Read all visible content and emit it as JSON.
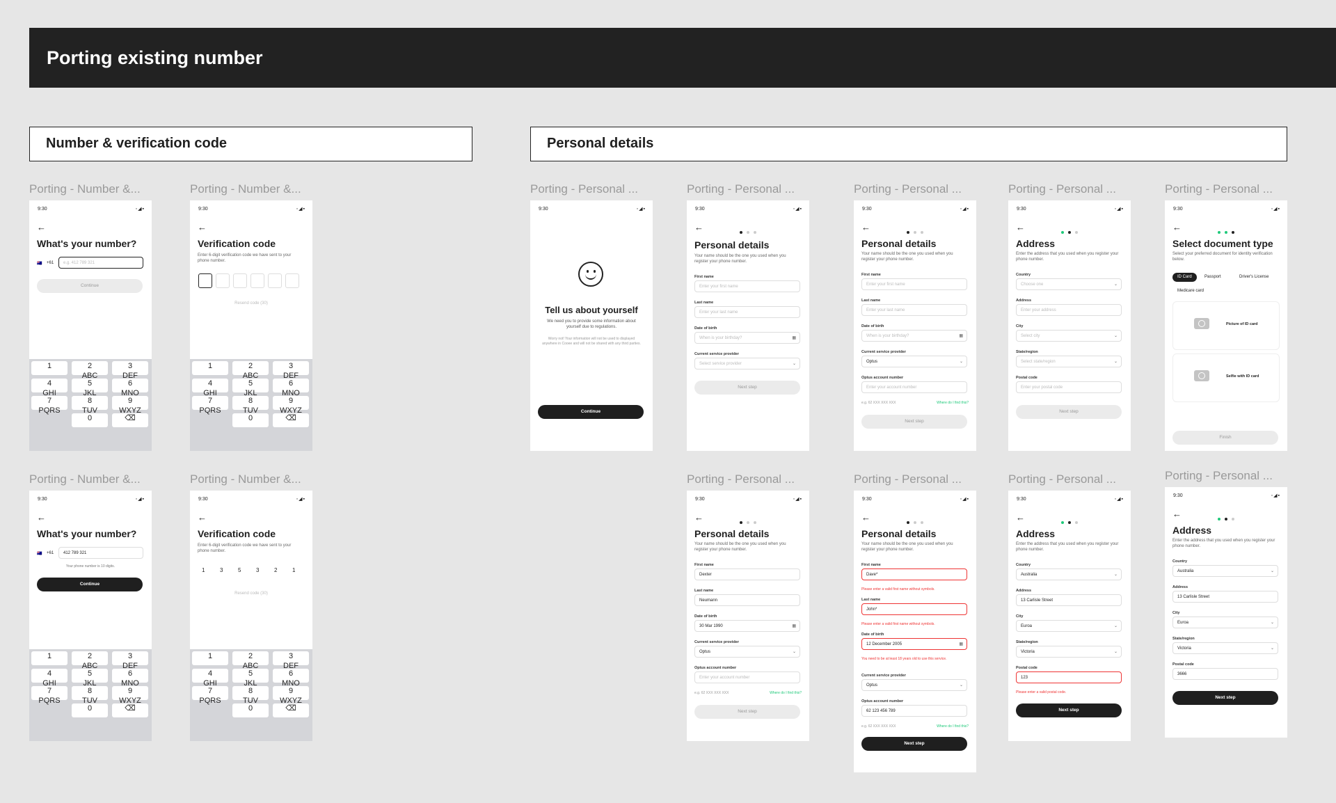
{
  "banner": "Porting existing number",
  "sections": {
    "number": "Number & verification code",
    "personal": "Personal details"
  },
  "labels": {
    "number": "Porting - Number &...",
    "personal": "Porting - Personal ..."
  },
  "time": "9:30",
  "status_icons": "◦◢▪",
  "back": "←",
  "num": {
    "title": "What's your number?",
    "flag": "🇦🇺",
    "code": "+61",
    "placeholder": "e.g. 412 789 321",
    "filled": "412 789 321",
    "helper": "Your phone number is 10 digits.",
    "continue": "Continue"
  },
  "ver": {
    "title": "Verification code",
    "sub": "Enter 6-digit verification code we have sent to your phone number.",
    "resend": "Resend code (30)",
    "digits": [
      "1",
      "3",
      "5",
      "3",
      "2",
      "1"
    ]
  },
  "keypad": [
    {
      "n": "1",
      "l": ""
    },
    {
      "n": "2",
      "l": "ABC"
    },
    {
      "n": "3",
      "l": "DEF"
    },
    {
      "n": "4",
      "l": "GHI"
    },
    {
      "n": "5",
      "l": "JKL"
    },
    {
      "n": "6",
      "l": "MNO"
    },
    {
      "n": "7",
      "l": "PQRS"
    },
    {
      "n": "8",
      "l": "TUV"
    },
    {
      "n": "9",
      "l": "WXYZ"
    },
    {
      "n": "",
      "l": ""
    },
    {
      "n": "0",
      "l": ""
    },
    {
      "n": "⌫",
      "l": ""
    }
  ],
  "intro": {
    "title": "Tell us about yourself",
    "p1": "We need you to provide some information about yourself due to regulations.",
    "p2": "Worry not! Your information will not be used to displayed anywhere in Cooee and will not be shared with any third parties.",
    "continue": "Continue"
  },
  "pd": {
    "title": "Personal details",
    "sub": "Your name should be the one you used when you register your phone number.",
    "first": "First name",
    "first_ph": "Enter your first name",
    "last": "Last name",
    "last_ph": "Enter your last name",
    "dob": "Date of birth",
    "dob_ph": "When is your birthday?",
    "provider": "Current service provider",
    "provider_ph": "Select service provider",
    "acct": "Optus account number",
    "acct_ph": "Enter your account number",
    "acct_hint": "e.g. 62 XXX XXX XXX",
    "find": "Where do I find this?",
    "next": "Next step",
    "optus": "Optus",
    "v_first": "Dexter",
    "v_last": "Neumann",
    "v_dob": "30 Mar 1990",
    "e_first": "Dave*",
    "e_last": "John*",
    "e_dob": "12 December 2005",
    "e_acct": "62 123 456 789",
    "err_name": "Please enter a valid first name without symbols.",
    "err_last": "Please enter a valid first name without symbols.",
    "err_age": "You need to be at least 18 years old to use this service."
  },
  "addr": {
    "title": "Address",
    "sub": "Enter the address that you used when you register your phone number.",
    "country": "Country",
    "country_ph": "Choose one",
    "address": "Address",
    "address_ph": "Enter your address",
    "city": "City",
    "city_ph": "Select city",
    "state": "State/region",
    "state_ph": "Select state/region",
    "postal": "Postal code",
    "postal_ph": "Enter your postal code",
    "next": "Next step",
    "v_country": "Australia",
    "v_address": "13 Carlisle Street",
    "v_city": "Euroa",
    "v_state": "Victoria",
    "v_postal_err": "123",
    "v_postal": "3666",
    "err_postal": "Please enter a valid postal code."
  },
  "doc": {
    "title": "Select document type",
    "sub": "Select your preferred document for identity verification below.",
    "chips": [
      "ID Card",
      "Passport",
      "Driver's License",
      "Medicare card"
    ],
    "up1": "Picture of ID card",
    "up2": "Selfie with ID card",
    "finish": "Finish"
  }
}
